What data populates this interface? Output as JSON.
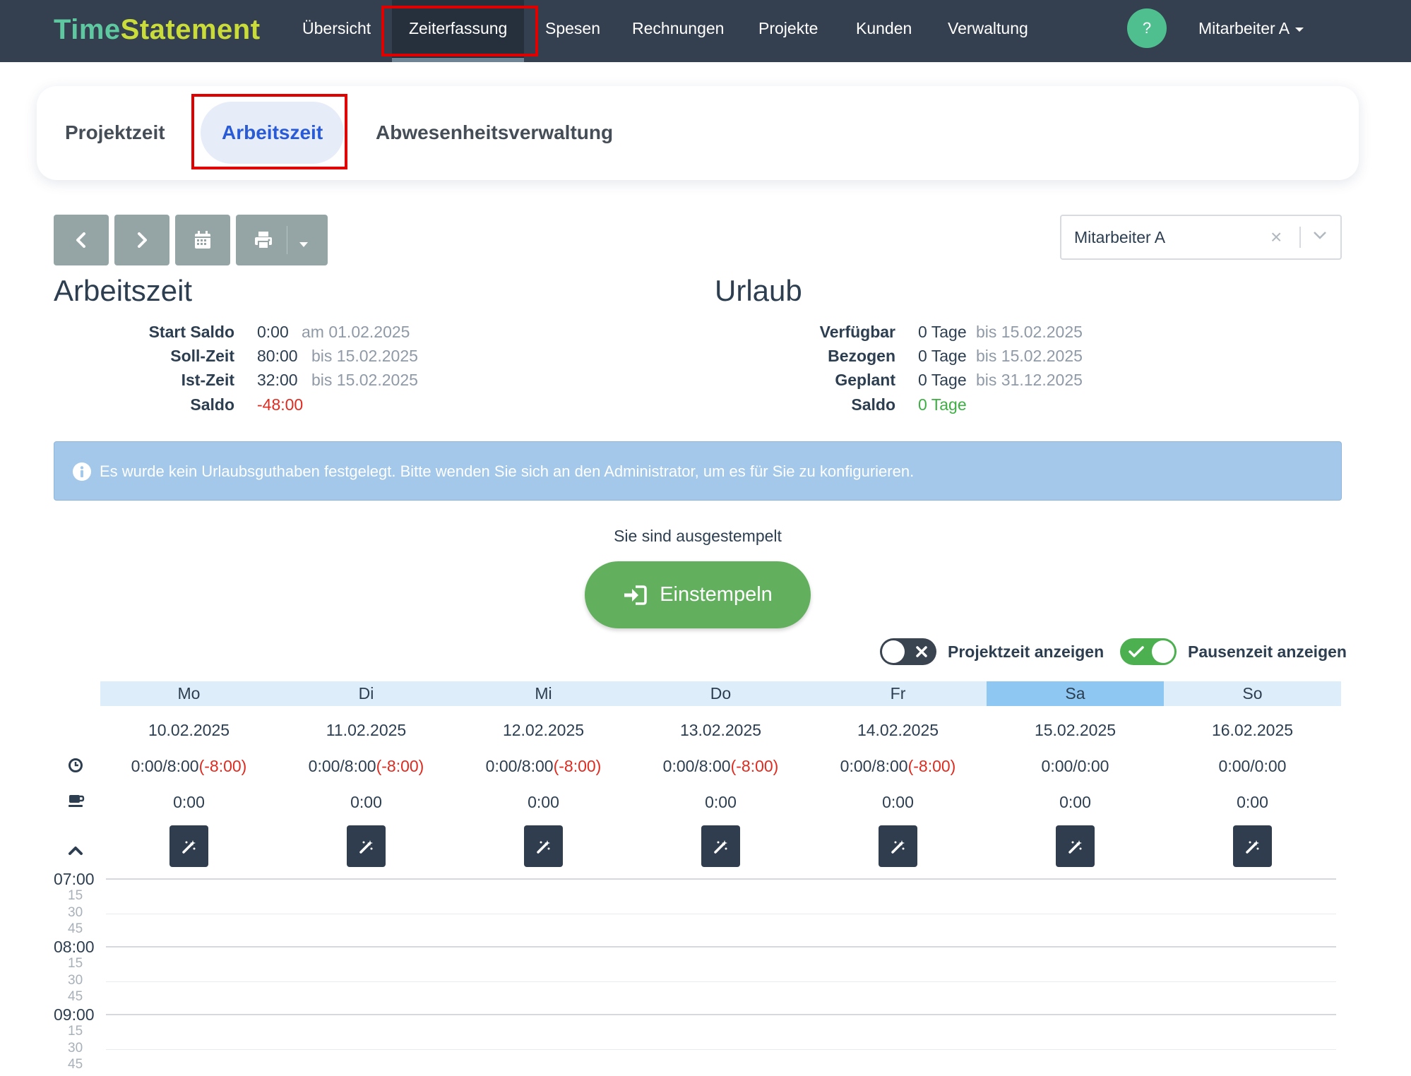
{
  "brand": {
    "part1": "Time",
    "part2": "Statement"
  },
  "nav": {
    "items": [
      {
        "label": "Übersicht"
      },
      {
        "label": "Zeiterfassung"
      },
      {
        "label": "Spesen"
      },
      {
        "label": "Rechnungen"
      },
      {
        "label": "Projekte"
      },
      {
        "label": "Kunden"
      },
      {
        "label": "Verwaltung"
      }
    ],
    "active": "Zeiterfassung",
    "help_label": "?",
    "user": "Mitarbeiter A"
  },
  "subtabs": {
    "items": [
      {
        "label": "Projektzeit"
      },
      {
        "label": "Arbeitszeit"
      },
      {
        "label": "Abwesenheitsverwaltung"
      }
    ],
    "active": "Arbeitszeit"
  },
  "toolbar": {
    "icons": [
      "chevron-left-icon",
      "chevron-right-icon",
      "calendar-icon",
      "print-icon",
      "caret-down-icon"
    ],
    "employee_select": {
      "value": "Mitarbeiter A",
      "clear_symbol": "×"
    }
  },
  "arbeitszeit": {
    "title": "Arbeitszeit",
    "rows": [
      {
        "label": "Start Saldo",
        "value": "0:00",
        "note": "am 01.02.2025"
      },
      {
        "label": "Soll-Zeit",
        "value": "80:00",
        "note": "bis 15.02.2025"
      },
      {
        "label": "Ist-Zeit",
        "value": "32:00",
        "note": "bis 15.02.2025"
      },
      {
        "label": "Saldo",
        "value": "-48:00",
        "note": ""
      }
    ]
  },
  "urlaub": {
    "title": "Urlaub",
    "rows": [
      {
        "label": "Verfügbar",
        "value": "0 Tage",
        "note": "bis 15.02.2025"
      },
      {
        "label": "Bezogen",
        "value": "0 Tage",
        "note": "bis 15.02.2025"
      },
      {
        "label": "Geplant",
        "value": "0 Tage",
        "note": "bis 31.12.2025"
      },
      {
        "label": "Saldo",
        "value": "0 Tage",
        "note": ""
      }
    ]
  },
  "alert": {
    "icon": "info-icon",
    "text": "Es wurde kein Urlaubsguthaben festgelegt. Bitte wenden Sie sich an den Administrator, um es für Sie zu konfigurieren."
  },
  "stamp": {
    "status": "Sie sind ausgestempelt",
    "button_label": "Einstempeln",
    "button_icon": "sign-in-icon"
  },
  "toggles": {
    "projektzeit": {
      "label": "Projektzeit anzeigen",
      "on": false
    },
    "pausenzeit": {
      "label": "Pausenzeit anzeigen",
      "on": true
    }
  },
  "week": {
    "days": [
      {
        "name": "Mo",
        "date": "10.02.2025",
        "time": "0:00/8:00",
        "diff": "(-8:00)",
        "pause": "0:00"
      },
      {
        "name": "Di",
        "date": "11.02.2025",
        "time": "0:00/8:00",
        "diff": "(-8:00)",
        "pause": "0:00"
      },
      {
        "name": "Mi",
        "date": "12.02.2025",
        "time": "0:00/8:00",
        "diff": "(-8:00)",
        "pause": "0:00"
      },
      {
        "name": "Do",
        "date": "13.02.2025",
        "time": "0:00/8:00",
        "diff": "(-8:00)",
        "pause": "0:00"
      },
      {
        "name": "Fr",
        "date": "14.02.2025",
        "time": "0:00/8:00",
        "diff": "(-8:00)",
        "pause": "0:00"
      },
      {
        "name": "Sa",
        "date": "15.02.2025",
        "time": "0:00/0:00",
        "diff": "",
        "pause": "0:00"
      },
      {
        "name": "So",
        "date": "16.02.2025",
        "time": "0:00/0:00",
        "diff": "",
        "pause": "0:00"
      }
    ],
    "today": "Sa",
    "row_icons": [
      "clock-icon",
      "coffee-icon",
      "chevron-up-icon"
    ],
    "day_button_icon": "magic-wand-icon"
  },
  "timeline": {
    "hours": [
      "07:00",
      "08:00",
      "09:00"
    ],
    "quarters": [
      "15",
      "30",
      "45"
    ]
  },
  "colors": {
    "navbar": "#34404f",
    "brand_time": "#5ec9a0",
    "brand_statement": "#c9dc3a",
    "highlight": "#e00000",
    "negative": "#e02b20",
    "positive": "#3cb043",
    "stamp_button": "#62b05e",
    "alert_bg": "#a3c8ea",
    "today_header": "#8ec8f2"
  }
}
